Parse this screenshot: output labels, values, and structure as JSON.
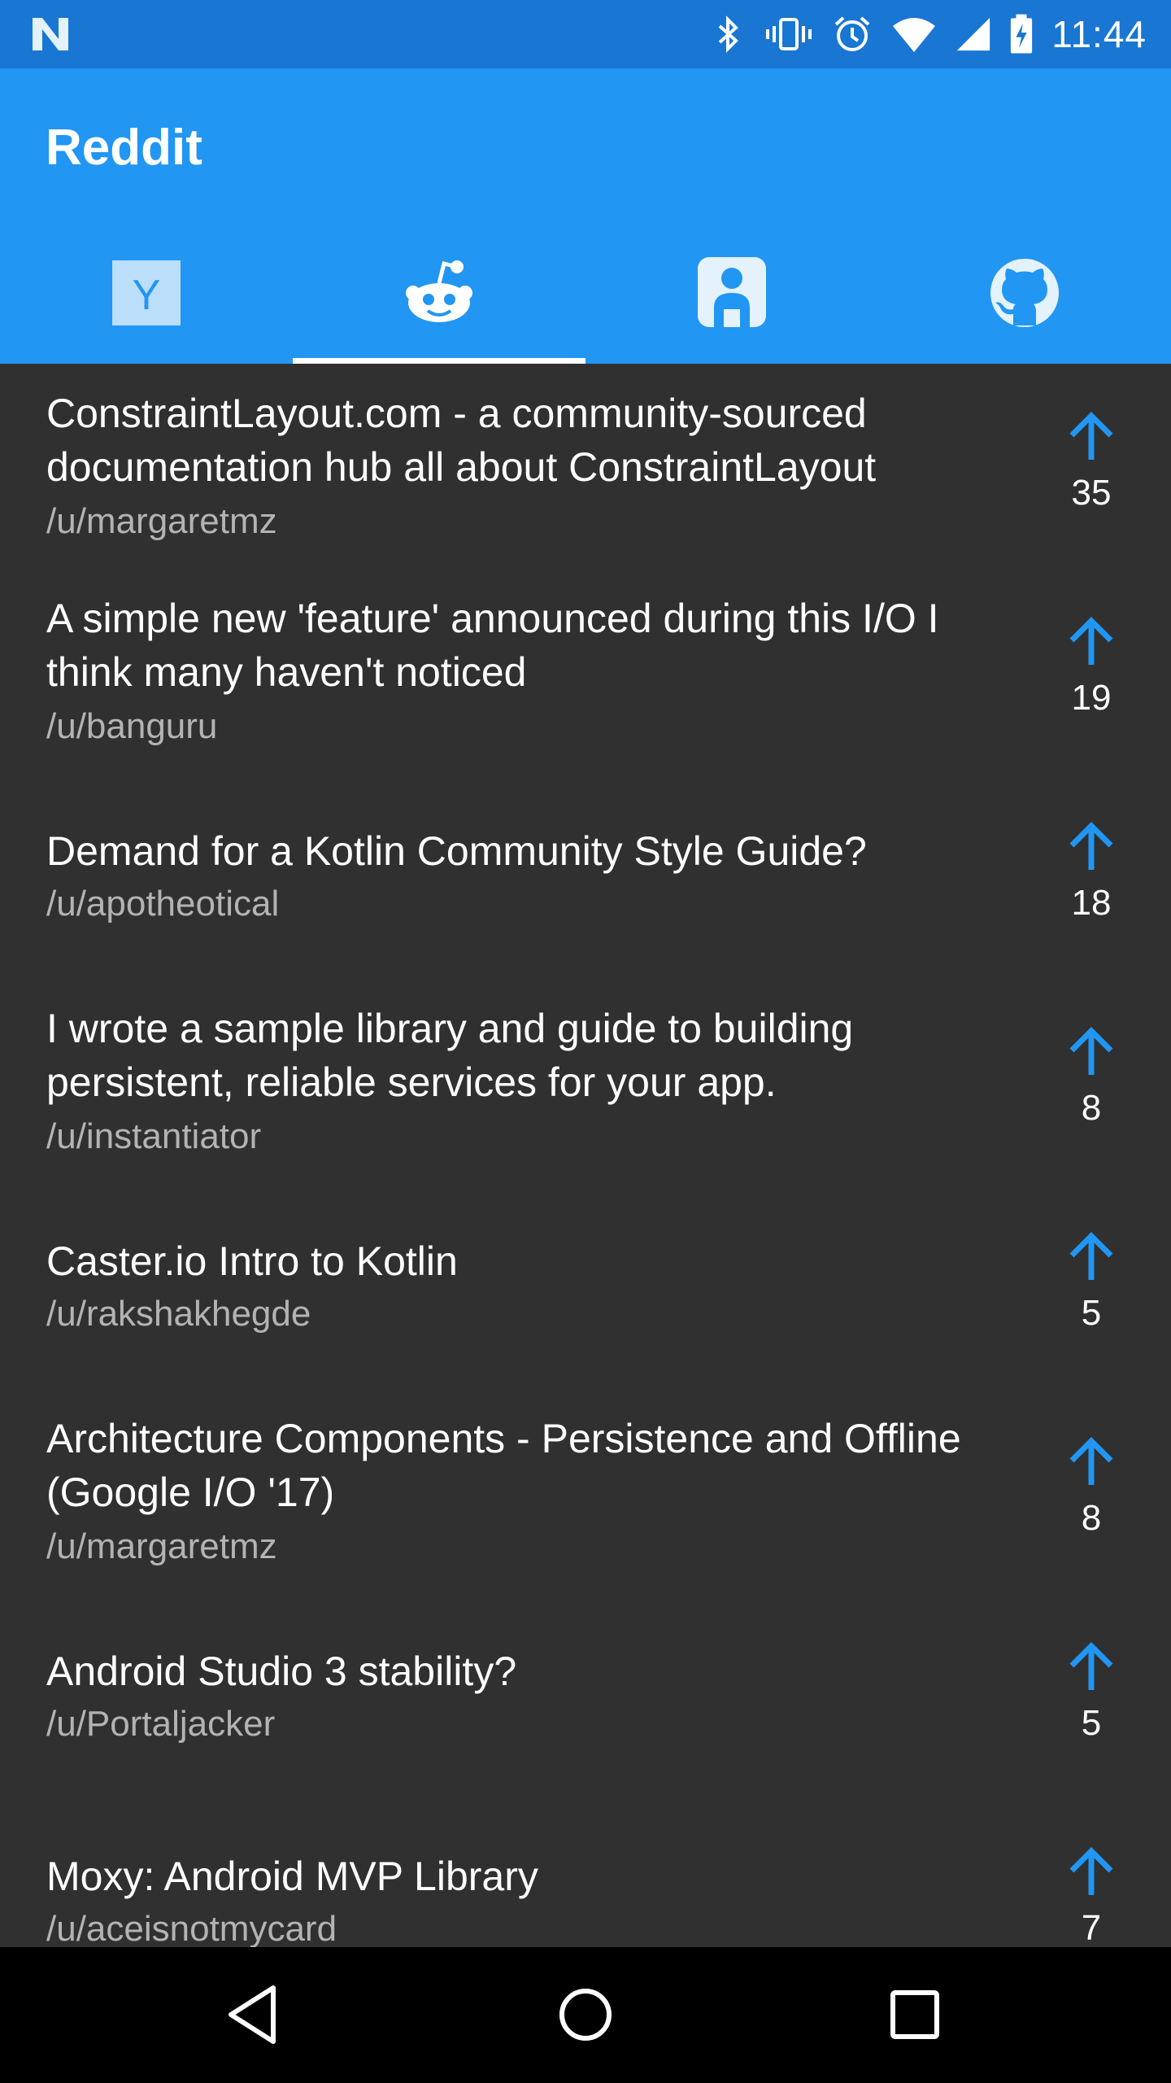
{
  "status_bar": {
    "time": "11:44",
    "icons": [
      "n-logo-icon",
      "bluetooth-icon",
      "vibrate-icon",
      "alarm-icon",
      "wifi-icon",
      "signal-icon",
      "battery-charging-icon"
    ]
  },
  "app_bar": {
    "title": "Reddit",
    "tabs": [
      {
        "icon": "hacker-news-icon",
        "glyph": "Y",
        "selected": false
      },
      {
        "icon": "reddit-icon",
        "selected": true
      },
      {
        "icon": "designer-news-icon",
        "selected": false
      },
      {
        "icon": "github-icon",
        "selected": false
      }
    ],
    "colors": {
      "primary": "#2196f3",
      "primary_dark": "#1976d2",
      "accent": "#2196f3"
    }
  },
  "posts": [
    {
      "title": "ConstraintLayout.com - a community-sourced documentation hub all about ConstraintLayout",
      "author": "/u/margaretmz",
      "votes": "35"
    },
    {
      "title": "A simple new 'feature' announced during this I/O I think many haven't noticed",
      "author": "/u/banguru",
      "votes": "19"
    },
    {
      "title": "Demand for a Kotlin Community Style Guide?",
      "author": "/u/apotheotical",
      "votes": "18"
    },
    {
      "title": "I wrote a sample library and guide to building persistent, reliable services for your app.",
      "author": "/u/instantiator",
      "votes": "8"
    },
    {
      "title": "Caster.io Intro to Kotlin",
      "author": "/u/rakshakhegde",
      "votes": "5"
    },
    {
      "title": "Architecture Components - Persistence and Offline (Google I/O '17)",
      "author": "/u/margaretmz",
      "votes": "8"
    },
    {
      "title": "Android Studio 3 stability?",
      "author": "/u/Portaljacker",
      "votes": "5"
    },
    {
      "title": "Moxy: Android MVP Library",
      "author": "/u/aceisnotmycard",
      "votes": "7"
    }
  ],
  "nav_bar": {
    "buttons": [
      "back-icon",
      "home-icon",
      "recents-icon"
    ]
  }
}
